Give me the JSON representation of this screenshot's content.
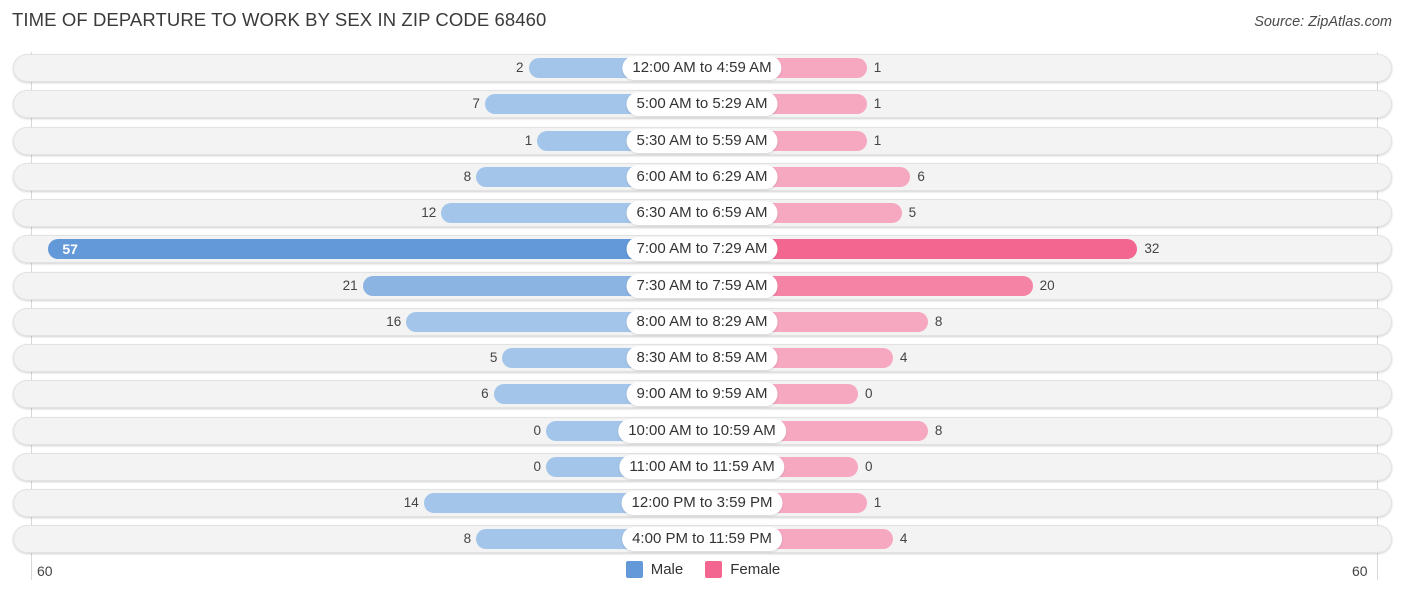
{
  "header": {
    "title": "TIME OF DEPARTURE TO WORK BY SEX IN ZIP CODE 68460",
    "source": "Source: ZipAtlas.com"
  },
  "colors": {
    "male": "#6399d8",
    "male_light": "#a4c5ea",
    "female": "#f2668f",
    "female_light": "#f5a8c0"
  },
  "chart_data": {
    "type": "bar",
    "orientation": "horizontal-diverging",
    "title": "TIME OF DEPARTURE TO WORK BY SEX IN ZIP CODE 68460",
    "categories": [
      "12:00 AM to 4:59 AM",
      "5:00 AM to 5:29 AM",
      "5:30 AM to 5:59 AM",
      "6:00 AM to 6:29 AM",
      "6:30 AM to 6:59 AM",
      "7:00 AM to 7:29 AM",
      "7:30 AM to 7:59 AM",
      "8:00 AM to 8:29 AM",
      "8:30 AM to 8:59 AM",
      "9:00 AM to 9:59 AM",
      "10:00 AM to 10:59 AM",
      "11:00 AM to 11:59 AM",
      "12:00 PM to 3:59 PM",
      "4:00 PM to 11:59 PM"
    ],
    "series": [
      {
        "name": "Male",
        "values": [
          2,
          7,
          1,
          8,
          12,
          57,
          21,
          16,
          5,
          6,
          0,
          0,
          14,
          8
        ]
      },
      {
        "name": "Female",
        "values": [
          1,
          1,
          1,
          6,
          5,
          32,
          20,
          8,
          4,
          0,
          8,
          0,
          1,
          4
        ]
      }
    ],
    "xlim": [
      -60,
      60
    ],
    "axis_tick_labels": {
      "left": "60",
      "right": "60"
    },
    "legend": {
      "position": "bottom-center",
      "entries": [
        "Male",
        "Female"
      ]
    },
    "grid": false
  }
}
